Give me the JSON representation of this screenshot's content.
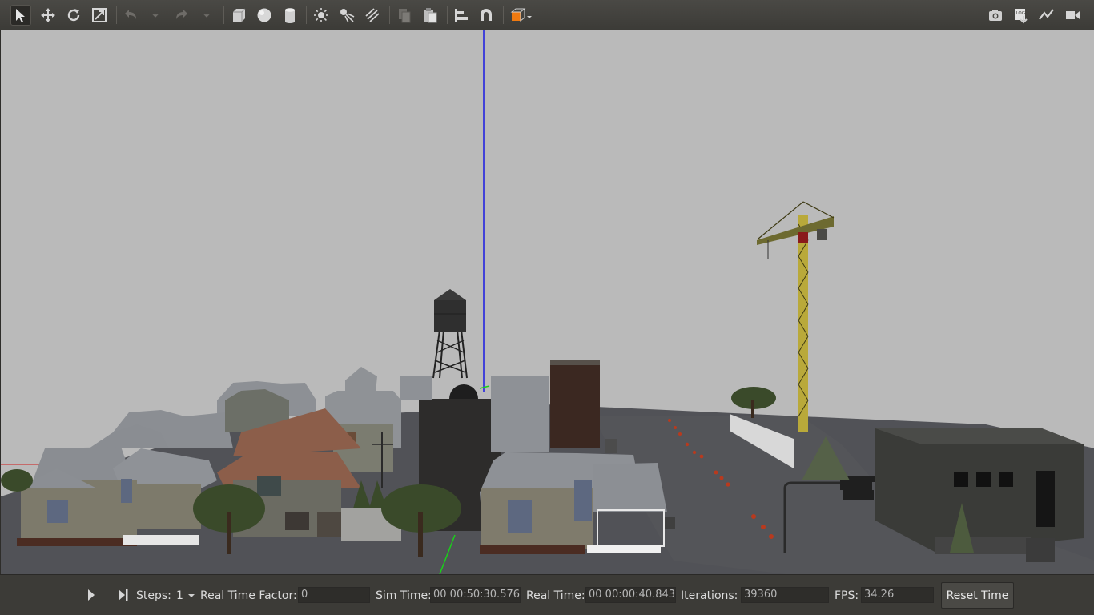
{
  "toolbar": {
    "left_tools": [
      "select-mode-icon",
      "translate-mode-icon",
      "rotate-mode-icon",
      "scale-mode-icon",
      "undo-icon",
      "undo-history-dropdown-icon",
      "redo-icon",
      "redo-history-dropdown-icon",
      "box-shape-icon",
      "sphere-shape-icon",
      "cylinder-shape-icon",
      "point-light-icon",
      "spot-light-icon",
      "directional-light-icon",
      "copy-icon",
      "paste-icon",
      "align-icon",
      "snap-icon",
      "view-angle-icon"
    ],
    "right_tools": [
      "screenshot-icon",
      "log-icon",
      "plot-icon",
      "video-record-icon"
    ],
    "log_badge": "LOG",
    "accent": "#f07a10"
  },
  "bottom_bar": {
    "steps_label": "Steps:",
    "steps_value": "1",
    "rtf_label": "Real Time Factor:",
    "rtf_value": "0",
    "sim_time_label": "Sim Time:",
    "sim_time_value": "00 00:50:30.576",
    "real_time_label": "Real Time:",
    "real_time_value": "00 00:00:40.843",
    "iterations_label": "Iterations:",
    "iterations_value": "39360",
    "fps_label": "FPS:",
    "fps_value": "34.26",
    "reset_label": "Reset Time"
  }
}
